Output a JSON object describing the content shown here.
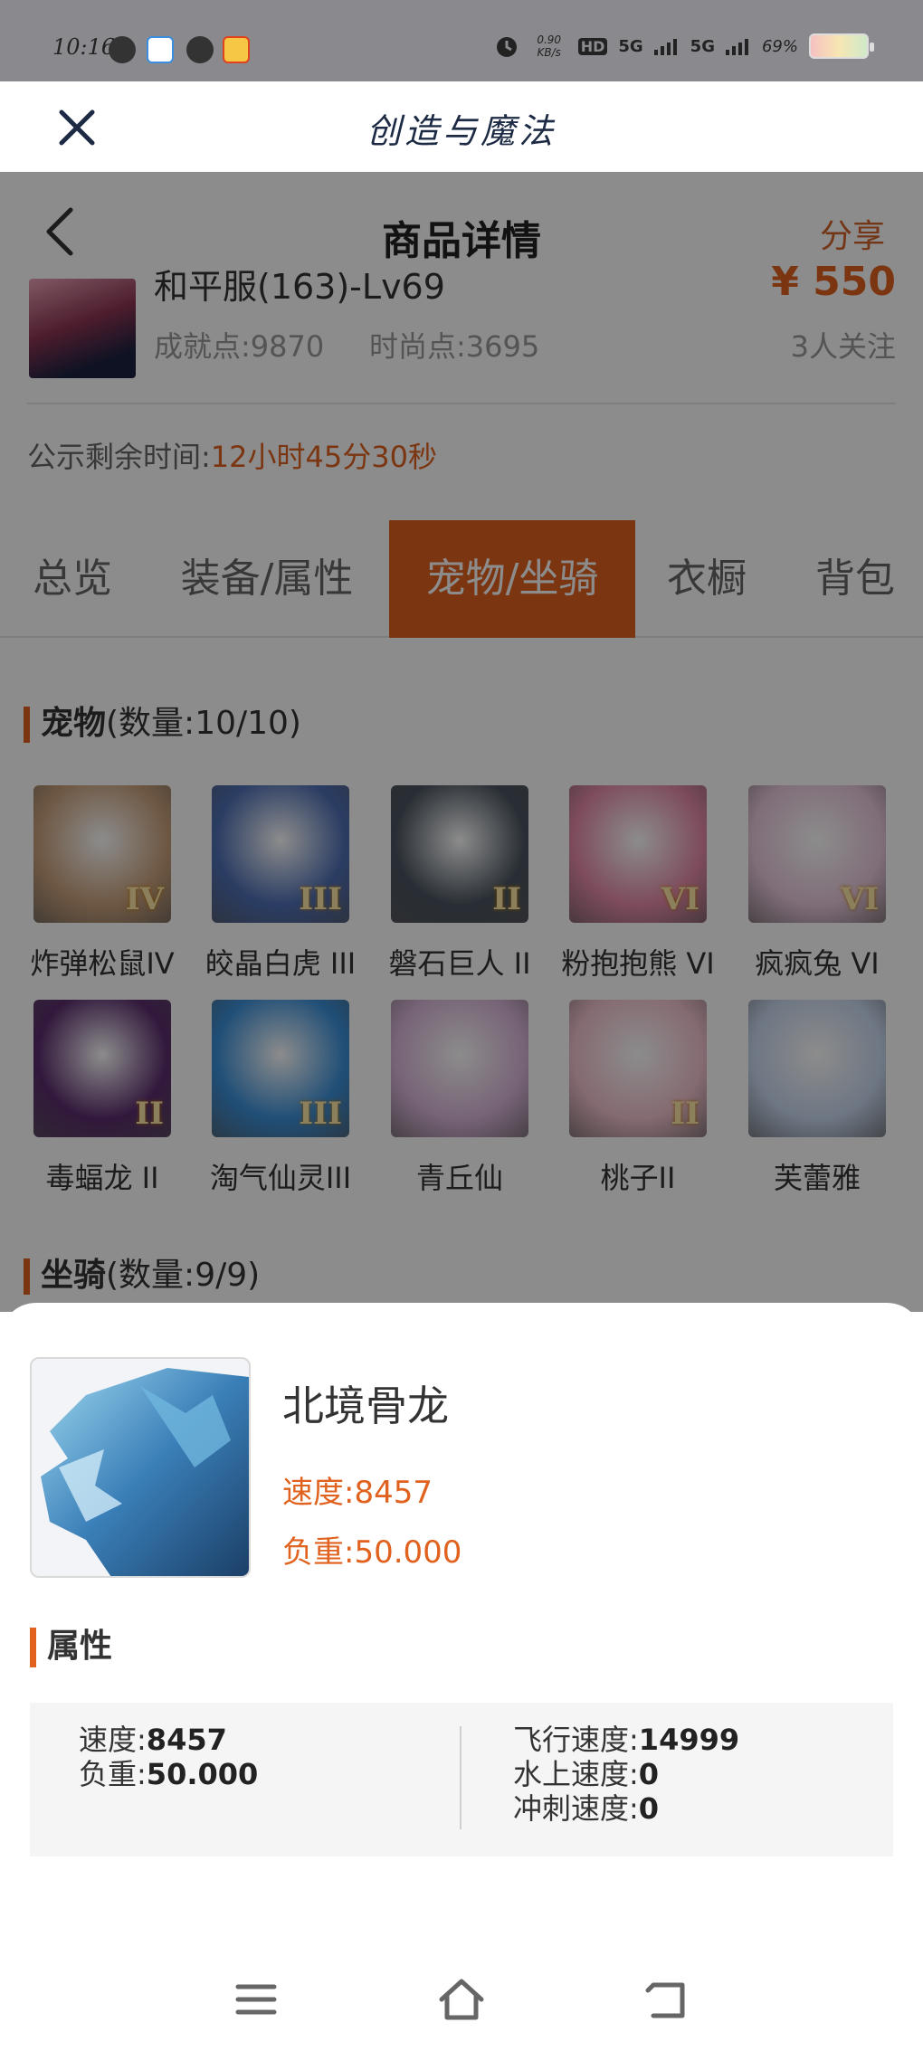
{
  "status_bar": {
    "time": "10:16",
    "network_speed": "0.90 KB/s",
    "signal_1": "5G",
    "signal_2": "5G",
    "battery": "69%"
  },
  "app_bar": {
    "title": "创造与魔法"
  },
  "nav": {
    "title": "商品详情",
    "share_label": "分享"
  },
  "product": {
    "name": "和平服(163)-Lv69",
    "price": "¥ 550",
    "achievement": "成就点:9870",
    "fashion": "时尚点:3695",
    "followers": "3人关注"
  },
  "countdown": {
    "label": "公示剩余时间:",
    "value": "12小时45分30秒"
  },
  "tabs": [
    {
      "label": "总览"
    },
    {
      "label": "装备/属性"
    },
    {
      "label": "宠物/坐骑"
    },
    {
      "label": "衣橱"
    },
    {
      "label": "背包"
    }
  ],
  "pets_section": {
    "title": "宠物",
    "count": "(数量:10/10)"
  },
  "pets": [
    {
      "label": "炸弹松鼠IV",
      "rank": "IV",
      "color": "#c9a07a"
    },
    {
      "label": "皎晶白虎 III",
      "rank": "III",
      "color": "#4e6fb5"
    },
    {
      "label": "磐石巨人 II",
      "rank": "II",
      "color": "#4b5560"
    },
    {
      "label": "粉抱抱熊 VI",
      "rank": "VI",
      "color": "#e58aa8"
    },
    {
      "label": "疯疯兔 VI",
      "rank": "VI",
      "color": "#e9c8dc"
    },
    {
      "label": "毒蝠龙 II",
      "rank": "II",
      "color": "#5b2d6e"
    },
    {
      "label": "淘气仙灵III",
      "rank": "III",
      "color": "#3a8fd8"
    },
    {
      "label": "青丘仙",
      "rank": "",
      "color": "#d9b6d8"
    },
    {
      "label": "桃子II",
      "rank": "II",
      "color": "#f2c2cf"
    },
    {
      "label": "芙蕾雅",
      "rank": "",
      "color": "#c8d8ef"
    }
  ],
  "mounts_section": {
    "title": "坐骑",
    "count": "(数量:9/9)"
  },
  "detail": {
    "name": "北境骨龙",
    "speed": "速度:8457",
    "load": "负重:50.000",
    "attr_title": "属性",
    "left": {
      "speed_label": "速度:",
      "speed_value": "8457",
      "load_label": "负重:",
      "load_value": "50.000"
    },
    "right": {
      "fly_label": "飞行速度:",
      "fly_value": "14999",
      "water_label": "水上速度:",
      "water_value": "0",
      "dash_label": "冲刺速度:",
      "dash_value": "0"
    }
  },
  "colors": {
    "accent": "#e0621e",
    "title_navy": "#1c2a44"
  }
}
